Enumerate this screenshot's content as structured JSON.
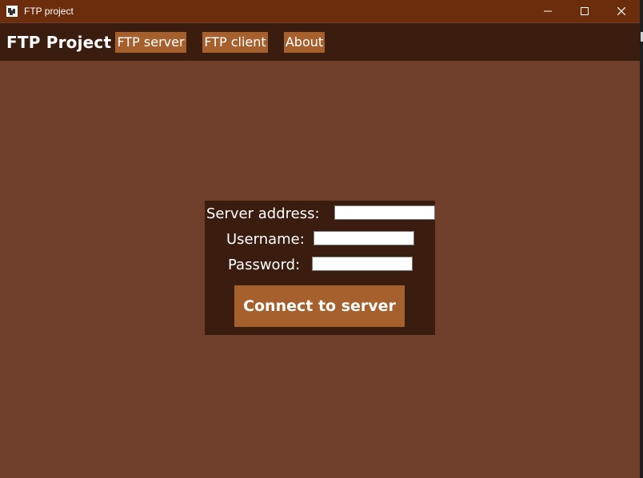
{
  "window": {
    "title": "FTP project",
    "icon": "app-icon",
    "controls": {
      "minimize_icon": "minimize-icon",
      "maximize_icon": "maximize-icon",
      "close_icon": "close-icon"
    }
  },
  "navbar": {
    "brand": "FTP Project",
    "items": [
      {
        "label": "FTP server"
      },
      {
        "label": "FTP client"
      },
      {
        "label": "About"
      }
    ]
  },
  "form": {
    "server_address": {
      "label": "Server address:",
      "value": ""
    },
    "username": {
      "label": "Username:",
      "value": ""
    },
    "password": {
      "label": "Password:",
      "value": ""
    },
    "connect_label": "Connect to server"
  },
  "colors": {
    "titlebar": "#6b2d0b",
    "navbar": "#3a1d0f",
    "background": "#6f3f2b",
    "button": "#a5602d",
    "text": "#ffffff"
  }
}
